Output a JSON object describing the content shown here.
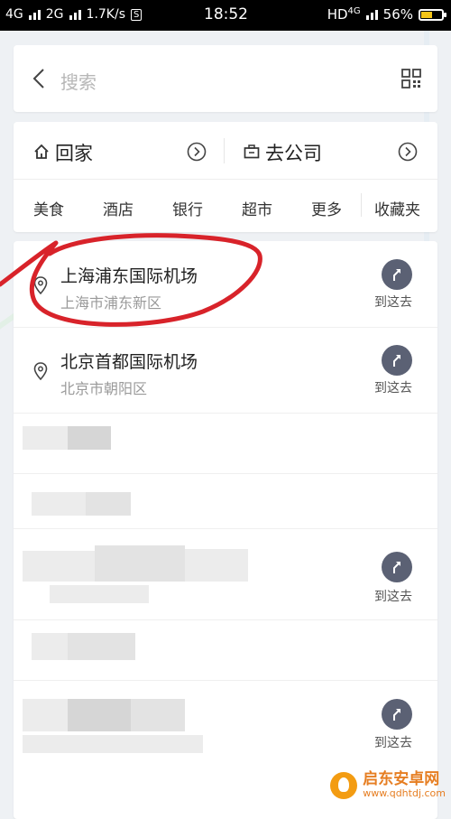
{
  "status_bar": {
    "net1": "4G",
    "net2": "2G",
    "speed": "1.7K/s",
    "s_badge": "S",
    "time": "18:52",
    "hd": "HD",
    "hd_net": "4G",
    "battery_percent": "56%",
    "battery_level": 0.56
  },
  "search": {
    "placeholder": "搜索"
  },
  "shortcuts": {
    "home": "回家",
    "work": "去公司",
    "categories": [
      "美食",
      "酒店",
      "银行",
      "超市",
      "更多",
      "收藏夹"
    ]
  },
  "results": [
    {
      "title": "上海浦东国际机场",
      "subtitle": "上海市浦东新区",
      "action": "到这去"
    },
    {
      "title": "北京首都国际机场",
      "subtitle": "北京市朝阳区",
      "action": "到这去"
    },
    {
      "action": "到这去"
    },
    {
      "action": "到这去"
    }
  ],
  "watermark": {
    "title": "启东安卓网",
    "url": "www.qdhtdj.com"
  },
  "colors": {
    "annotation_red": "#d8232a",
    "go_button": "#5b6174"
  }
}
